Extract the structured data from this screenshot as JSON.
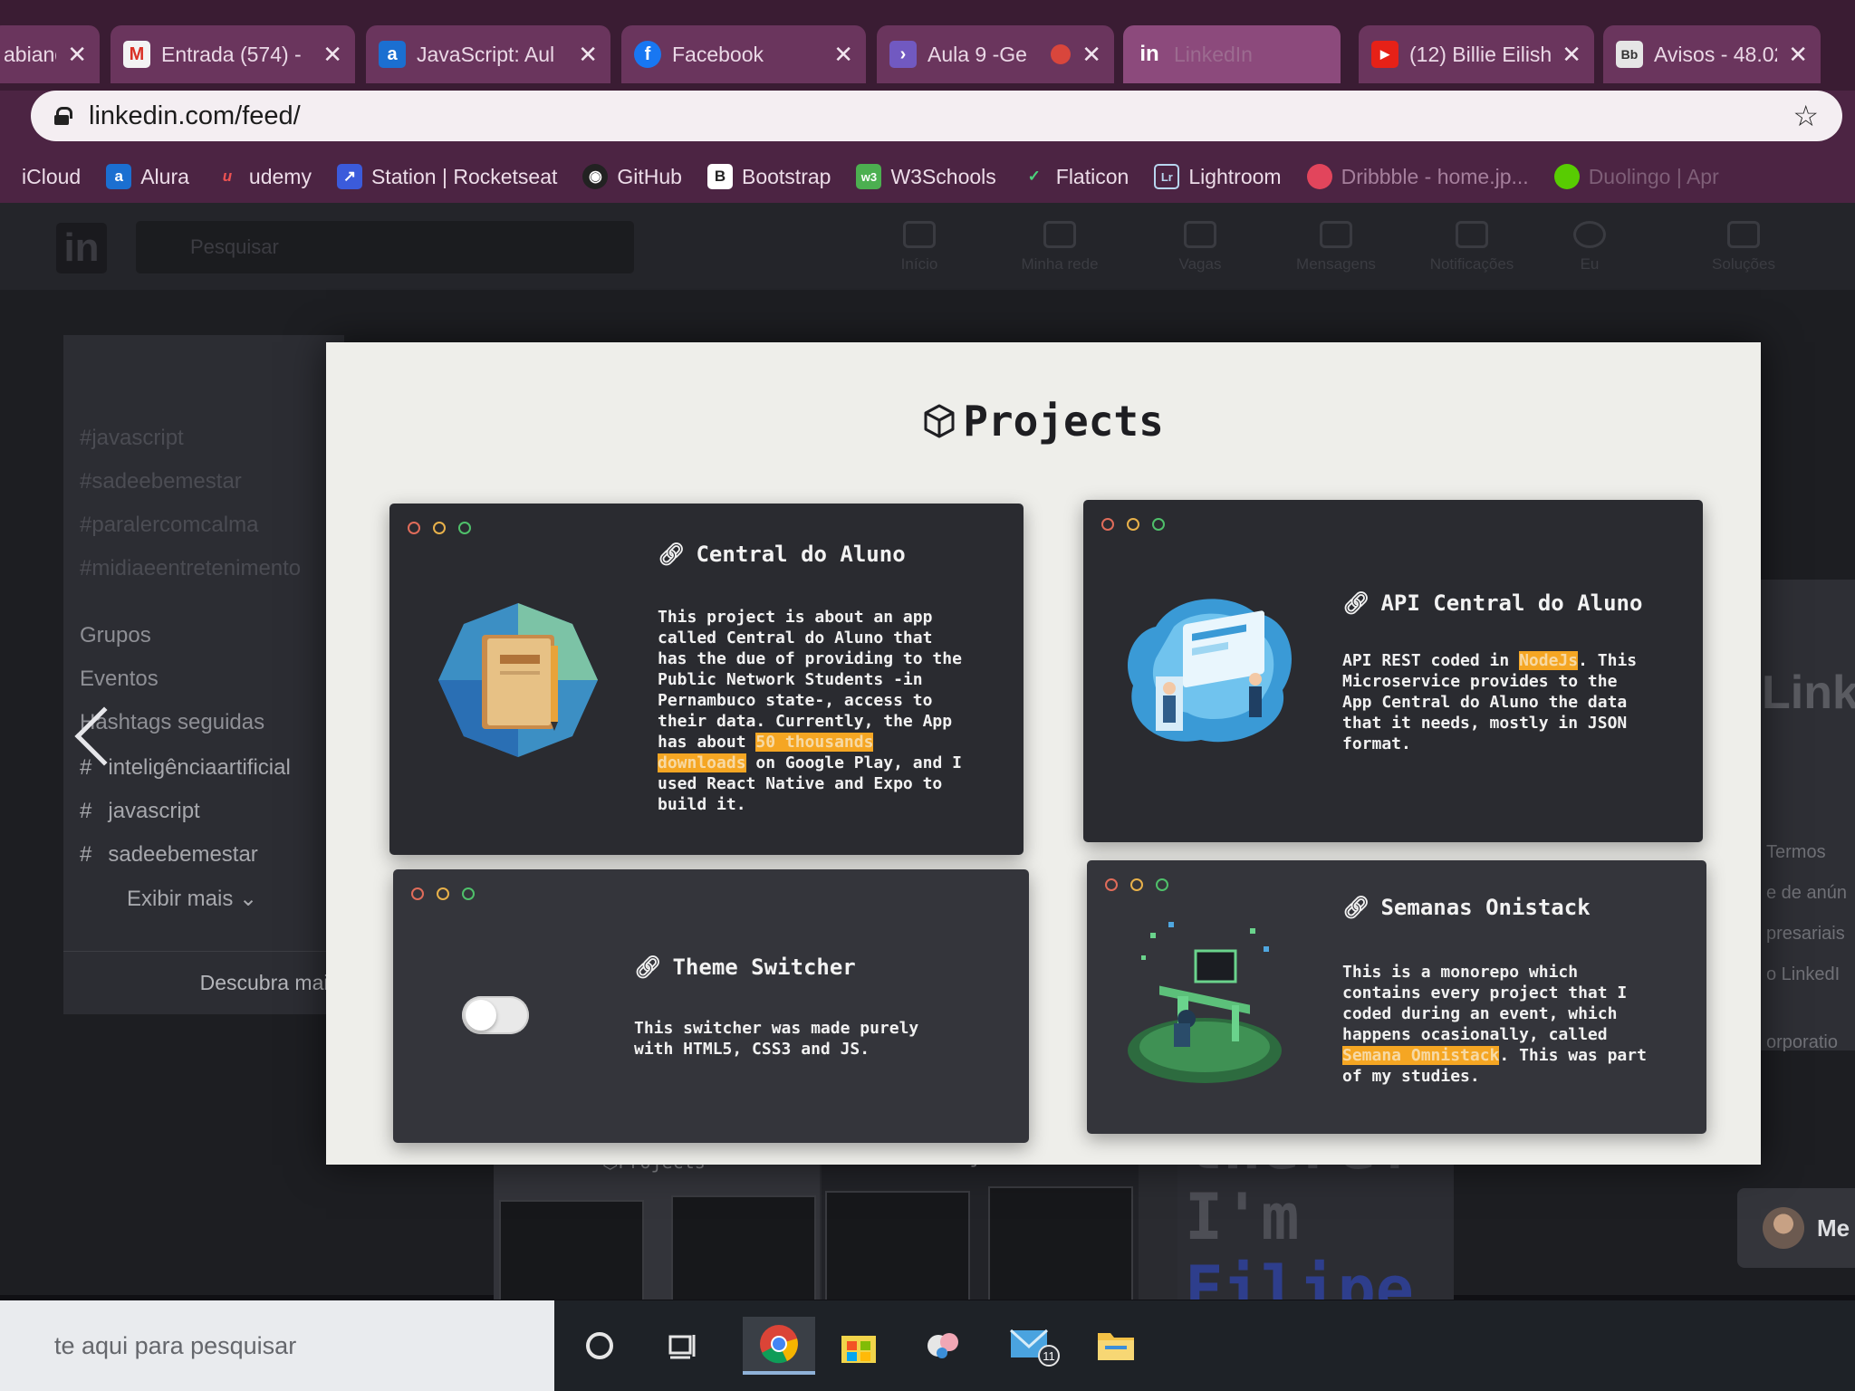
{
  "browser": {
    "tabs": [
      {
        "label": "abiand",
        "icon": "generic-tab-icon",
        "close": "✕"
      },
      {
        "label": "Entrada (574) -",
        "icon": "gmail-icon",
        "close": "✕"
      },
      {
        "label": "JavaScript: Aul",
        "icon": "alura-icon",
        "close": "✕"
      },
      {
        "label": "Facebook",
        "icon": "facebook-icon",
        "close": "✕"
      },
      {
        "label": "Aula 9 -Ge",
        "icon": "rocketseat-icon",
        "close": "✕"
      },
      {
        "label": "LinkedIn",
        "icon": "linkedin-icon",
        "close": ""
      },
      {
        "label": "(12) Billie Eilish",
        "icon": "youtube-icon",
        "close": "✕"
      },
      {
        "label": "Avisos - 48.02",
        "icon": "bb-icon",
        "close": "✕"
      }
    ],
    "url": "linkedin.com/feed/",
    "bookmarks": [
      {
        "label": "iCloud",
        "icon": "apple-icon"
      },
      {
        "label": "Alura",
        "icon": "alura-icon"
      },
      {
        "label": "udemy",
        "icon": "udemy-icon"
      },
      {
        "label": "Station | Rocketseat",
        "icon": "rocketseat-icon"
      },
      {
        "label": "GitHub",
        "icon": "github-icon"
      },
      {
        "label": "Bootstrap",
        "icon": "bootstrap-icon"
      },
      {
        "label": "W3Schools",
        "icon": "w3schools-icon"
      },
      {
        "label": "Flaticon",
        "icon": "flaticon-icon"
      },
      {
        "label": "Lightroom",
        "icon": "lightroom-icon"
      },
      {
        "label": "Dribbble - home.jp...",
        "icon": "dribbble-icon"
      },
      {
        "label": "Duolingo | Apr",
        "icon": "duolingo-icon"
      }
    ]
  },
  "linkedin": {
    "search_placeholder": "Pesquisar",
    "nav": [
      "Início",
      "Minha rede",
      "Vagas",
      "Mensagens",
      "Notificações",
      "Eu",
      "Soluções"
    ],
    "sidebar": {
      "recent": [
        "#javascript",
        "#sadeebemestar",
        "#paralercomcalma",
        "#midiaeentretenimento"
      ],
      "groups": "Grupos",
      "events": "Eventos",
      "followed_hashtags_heading": "Hashtags seguidas",
      "followed_hashtags": [
        "inteligênciaartificial",
        "javascript",
        "sadeebemestar"
      ],
      "show_more": "Exibir mais",
      "discover_more": "Descubra mais"
    },
    "right_rail": [
      "Termos",
      "e de anún",
      "presariais",
      "o LinkedI",
      "orporatio"
    ],
    "right_big": "Link",
    "thumb_strip": {
      "title": "⬡Projects",
      "big_text_1": "there!",
      "big_text_2": "I'm",
      "big_text_3": "Filipe"
    },
    "messaging_label": "Me"
  },
  "modal": {
    "title": "Projects",
    "title_icon": "cube-icon",
    "cards": [
      {
        "title": "Central do Aluno",
        "illustration": "notebook-illustration",
        "desc_before": "This project is about an app\ncalled Central do Aluno that\nhas the due of providing to the\nPublic Network Students -in\nPernambuco state-, access to\ntheir data. Currently, the App\nhas about ",
        "desc_highlight_1": "50 thousands",
        "desc_mid": "\n",
        "desc_highlight_2": "downloads",
        "desc_after": " on Google Play, and I\nused React Native and Expo to\nbuild it."
      },
      {
        "title": "API Central do Aluno",
        "illustration": "server-team-illustration",
        "desc_before": "API REST coded in ",
        "desc_highlight": "NodeJs",
        "desc_after": ". This\nMicroservice provides to the\nApp Central do Aluno the data\nthat it needs, mostly in JSON\nformat."
      },
      {
        "title": "Theme Switcher",
        "illustration": "toggle-switch",
        "desc": "This switcher was made purely\nwith HTML5, CSS3 and JS."
      },
      {
        "title": "Semanas Onistack",
        "illustration": "workstation-illustration",
        "desc_before": "This is a monorepo which\ncontains every project that I\ncoded during an event, which\nhappens ocasionally, called\n",
        "desc_highlight": "Semana Omnistack",
        "desc_after": ". This was part\nof my studies."
      }
    ]
  },
  "taskbar": {
    "search_placeholder": "te aqui para pesquisar",
    "mail_badge": "11"
  }
}
